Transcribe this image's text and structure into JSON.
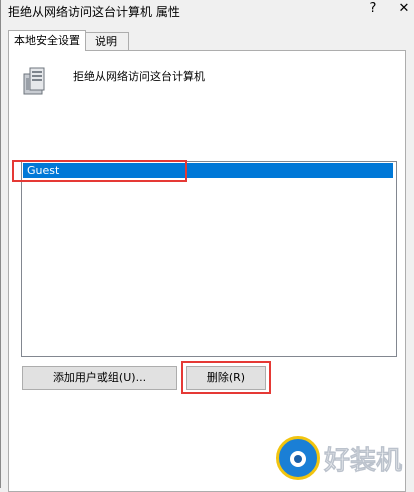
{
  "window": {
    "title": "拒绝从网络访问这台计算机 属性",
    "help_glyph": "?",
    "close_glyph": "✕"
  },
  "tabs": [
    {
      "label": "本地安全设置",
      "active": true
    },
    {
      "label": "说明",
      "active": false
    }
  ],
  "policy": {
    "icon": "server-icon",
    "title": "拒绝从网络访问这台计算机"
  },
  "user_list": {
    "items": [
      {
        "label": "Guest",
        "selected": true
      }
    ]
  },
  "buttons": {
    "add_label": "添加用户或组(U)...",
    "remove_label": "删除(R)"
  },
  "watermark": {
    "text": "好装机",
    "icon": "eye-logo-icon"
  },
  "colors": {
    "selection": "#0078d7",
    "highlight_box": "#e53935",
    "dialog_bg": "#f0f0f0"
  }
}
